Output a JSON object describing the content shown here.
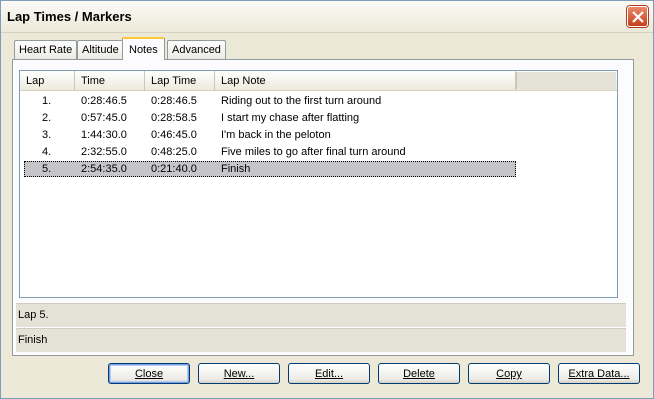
{
  "window": {
    "title": "Lap Times / Markers"
  },
  "tabs": [
    {
      "label": "Heart Rate",
      "active": false
    },
    {
      "label": "Altitude",
      "active": false
    },
    {
      "label": "Notes",
      "active": true
    },
    {
      "label": "Advanced",
      "active": false
    }
  ],
  "laps": {
    "columns": [
      "Lap",
      "Time",
      "Lap Time",
      "Lap Note"
    ],
    "rows": [
      {
        "lap": "1.",
        "time": "0:28:46.5",
        "lap_time": "0:28:46.5",
        "note": "Riding out to the first turn around"
      },
      {
        "lap": "2.",
        "time": "0:57:45.0",
        "lap_time": "0:28:58.5",
        "note": "I start my chase after flatting"
      },
      {
        "lap": "3.",
        "time": "1:44:30.0",
        "lap_time": "0:46:45.0",
        "note": "I'm back in the peloton"
      },
      {
        "lap": "4.",
        "time": "2:32:55.0",
        "lap_time": "0:48:25.0",
        "note": "Five miles to go after final turn around"
      },
      {
        "lap": "5.",
        "time": "2:54:35.0",
        "lap_time": "0:21:40.0",
        "note": "Finish"
      }
    ],
    "selected_index": 4
  },
  "info": {
    "lap_label": "Lap 5.",
    "note": "Finish"
  },
  "buttons": {
    "close": "Close",
    "new": "New...",
    "edit": "Edit...",
    "delete": "Delete",
    "copy": "Copy",
    "extra_data": "Extra Data..."
  },
  "colors": {
    "selection": "#c5c5c9",
    "tab_highlight": "#ffc83c",
    "close_button": "#c6401b"
  }
}
